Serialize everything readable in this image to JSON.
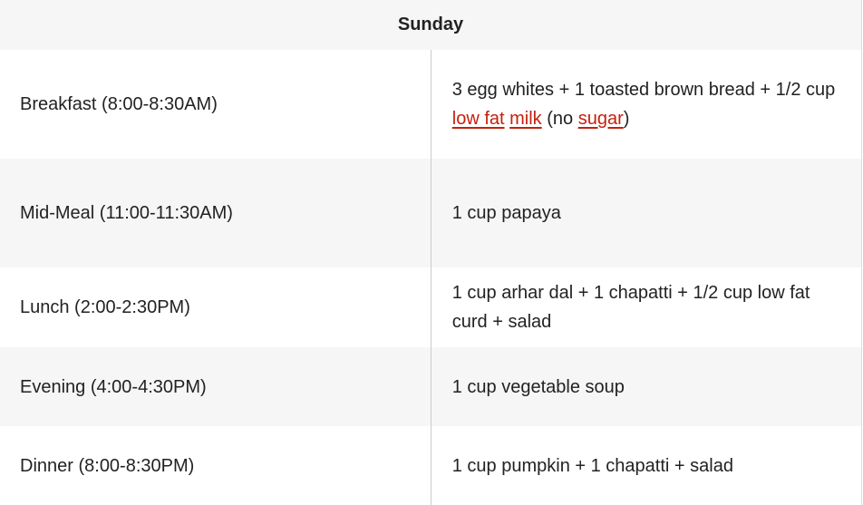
{
  "header": {
    "title": "Sunday"
  },
  "link_color": "#c4200e",
  "rows": [
    {
      "meal": "Breakfast (8:00-8:30AM)",
      "food": [
        {
          "text": "3 egg whites + 1 toasted brown bread + 1/2 cup "
        },
        {
          "text": "low fat",
          "link": true
        },
        {
          "text": " "
        },
        {
          "text": "milk",
          "link": true
        },
        {
          "text": " (no "
        },
        {
          "text": "sugar",
          "link": true
        },
        {
          "text": ")"
        }
      ]
    },
    {
      "meal": "Mid-Meal (11:00-11:30AM)",
      "food": [
        {
          "text": "1 cup papaya"
        }
      ]
    },
    {
      "meal": "Lunch (2:00-2:30PM)",
      "food": [
        {
          "text": "1 cup arhar dal + 1 chapatti + 1/2 cup low fat curd + salad"
        }
      ]
    },
    {
      "meal": "Evening (4:00-4:30PM)",
      "food": [
        {
          "text": "1 cup vegetable soup"
        }
      ]
    },
    {
      "meal": "Dinner (8:00-8:30PM)",
      "food": [
        {
          "text": "1 cup pumpkin + 1 chapatti + salad"
        }
      ]
    }
  ]
}
